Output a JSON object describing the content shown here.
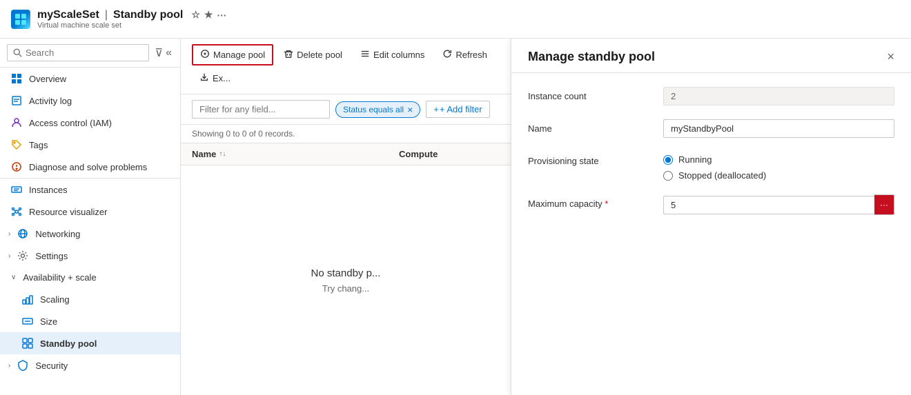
{
  "header": {
    "app_icon_label": "VMSS",
    "title_resource": "myScaleSet",
    "title_separator": "|",
    "title_page": "Standby pool",
    "title_subtitle": "Virtual machine scale set",
    "actions": [
      "★",
      "☆",
      "···"
    ]
  },
  "sidebar": {
    "search_placeholder": "Search",
    "nav_items": [
      {
        "id": "overview",
        "label": "Overview",
        "icon": "grid"
      },
      {
        "id": "activity-log",
        "label": "Activity log",
        "icon": "list"
      },
      {
        "id": "access-control",
        "label": "Access control (IAM)",
        "icon": "shield"
      },
      {
        "id": "tags",
        "label": "Tags",
        "icon": "tag"
      },
      {
        "id": "diagnose",
        "label": "Diagnose and solve problems",
        "icon": "wrench"
      },
      {
        "id": "instances",
        "label": "Instances",
        "icon": "server"
      },
      {
        "id": "resource-visualizer",
        "label": "Resource visualizer",
        "icon": "nodes"
      },
      {
        "id": "networking",
        "label": "Networking",
        "icon": "network",
        "hasChevron": true
      },
      {
        "id": "settings",
        "label": "Settings",
        "icon": "gear",
        "hasChevron": true
      },
      {
        "id": "availability-scale",
        "label": "Availability + scale",
        "icon": "scale",
        "expanded": true
      },
      {
        "id": "scaling",
        "label": "Scaling",
        "icon": "scaling",
        "indent": true
      },
      {
        "id": "size",
        "label": "Size",
        "icon": "size",
        "indent": true
      },
      {
        "id": "standby-pool",
        "label": "Standby pool",
        "icon": "pool",
        "indent": true,
        "active": true
      },
      {
        "id": "security",
        "label": "Security",
        "icon": "lock",
        "hasChevron": true
      }
    ]
  },
  "toolbar": {
    "manage_pool_label": "Manage pool",
    "delete_pool_label": "Delete pool",
    "edit_columns_label": "Edit columns",
    "refresh_label": "Refresh",
    "export_label": "Ex..."
  },
  "filter_bar": {
    "filter_placeholder": "Filter for any field...",
    "status_tag": "Status equals all",
    "add_filter_label": "+ Add filter"
  },
  "table": {
    "records_info": "Showing 0 to 0 of 0 records.",
    "columns": [
      {
        "id": "name",
        "label": "Name",
        "sort": "↑↓"
      },
      {
        "id": "compute",
        "label": "Compute"
      }
    ],
    "empty_title": "No standby p...",
    "empty_subtitle": "Try chang..."
  },
  "right_panel": {
    "title": "Manage standby pool",
    "close_label": "×",
    "fields": [
      {
        "id": "instance-count",
        "label": "Instance count",
        "type": "readonly",
        "value": "2"
      },
      {
        "id": "name",
        "label": "Name",
        "type": "text",
        "value": "myStandbyPool"
      },
      {
        "id": "provisioning-state",
        "label": "Provisioning state",
        "type": "radio",
        "options": [
          {
            "id": "running",
            "label": "Running",
            "checked": true
          },
          {
            "id": "stopped",
            "label": "Stopped (deallocated)",
            "checked": false
          }
        ]
      },
      {
        "id": "max-capacity",
        "label": "Maximum capacity",
        "type": "text-with-btn",
        "value": "5",
        "required": true,
        "btn_label": "···"
      }
    ]
  }
}
